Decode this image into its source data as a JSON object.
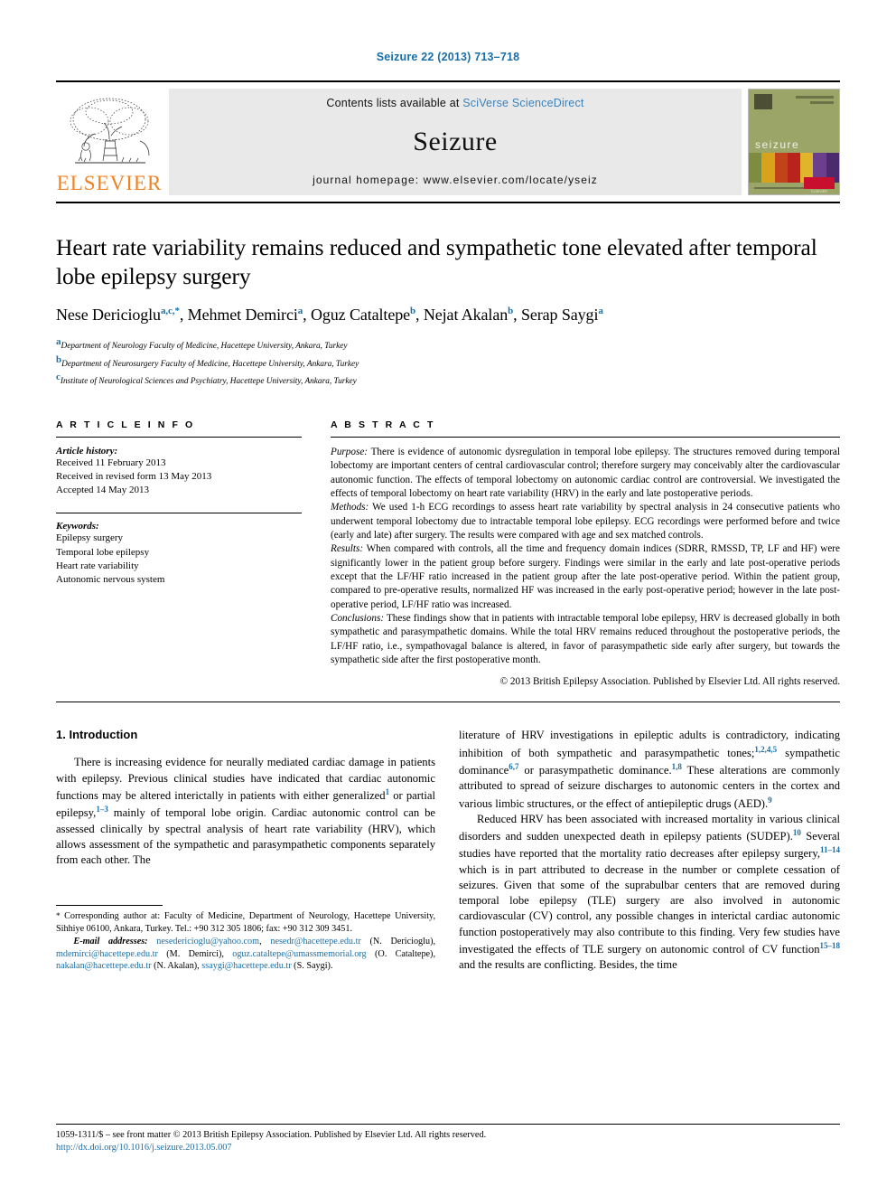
{
  "running_head": "Seizure 22 (2013) 713–718",
  "masthead": {
    "publisher_name": "ELSEVIER",
    "contents_prefix": "Contents lists available at ",
    "contents_link": "SciVerse ScienceDirect",
    "journal_name": "Seizure",
    "homepage": "journal homepage: www.elsevier.com/locate/yseiz",
    "cover": {
      "title": "seizure",
      "subtitle": "European Journal of Epilepsy",
      "publisher_badge": "ELSEVIER"
    }
  },
  "article": {
    "title": "Heart rate variability remains reduced and sympathetic tone elevated after temporal lobe epilepsy surgery",
    "authors": [
      {
        "name": "Nese Dericioglu",
        "sup": "a,c,*"
      },
      {
        "name": "Mehmet Demirci",
        "sup": "a"
      },
      {
        "name": "Oguz Cataltepe",
        "sup": "b"
      },
      {
        "name": "Nejat Akalan",
        "sup": "b"
      },
      {
        "name": "Serap Saygi",
        "sup": "a"
      }
    ],
    "affiliations": [
      {
        "mark": "a",
        "text": "Department of Neurology Faculty of Medicine, Hacettepe University, Ankara, Turkey"
      },
      {
        "mark": "b",
        "text": "Department of Neurosurgery Faculty of Medicine, Hacettepe University, Ankara, Turkey"
      },
      {
        "mark": "c",
        "text": "Institute of Neurological Sciences and Psychiatry, Hacettepe University, Ankara, Turkey"
      }
    ]
  },
  "article_info": {
    "heading": "A R T I C L E  I N F O",
    "history_label": "Article history:",
    "history": [
      "Received 11 February 2013",
      "Received in revised form 13 May 2013",
      "Accepted 14 May 2013"
    ],
    "keywords_label": "Keywords:",
    "keywords": [
      "Epilepsy surgery",
      "Temporal lobe epilepsy",
      "Heart rate variability",
      "Autonomic nervous system"
    ]
  },
  "abstract": {
    "heading": "A B S T R A C T",
    "purpose_label": "Purpose:",
    "purpose": " There is evidence of autonomic dysregulation in temporal lobe epilepsy. The structures removed during temporal lobectomy are important centers of central cardiovascular control; therefore surgery may conceivably alter the cardiovascular autonomic function. The effects of temporal lobectomy on autonomic cardiac control are controversial. We investigated the effects of temporal lobectomy on heart rate variability (HRV) in the early and late postoperative periods.",
    "methods_label": "Methods:",
    "methods": " We used 1-h ECG recordings to assess heart rate variability by spectral analysis in 24 consecutive patients who underwent temporal lobectomy due to intractable temporal lobe epilepsy. ECG recordings were performed before and twice (early and late) after surgery. The results were compared with age and sex matched controls.",
    "results_label": "Results:",
    "results": "  When compared with controls, all the time and frequency domain indices (SDRR, RMSSD, TP, LF and HF) were significantly lower in the patient group before surgery. Findings were similar in the early and late post-operative periods except that the LF/HF ratio increased in the patient group after the late post-operative period. Within the patient group, compared to pre-operative results, normalized HF was increased in the early post-operative period; however in the late post-operative period, LF/HF ratio was increased.",
    "conclusions_label": "Conclusions:",
    "conclusions": " These findings show that in patients with intractable temporal lobe epilepsy, HRV is decreased globally in both sympathetic and parasympathetic domains. While the total HRV remains reduced throughout the postoperative periods, the LF/HF ratio, i.e., sympathovagal balance is altered, in favor of parasympathetic side early after surgery, but towards the sympathetic side after the first postoperative month.",
    "copyright": "© 2013 British Epilepsy Association. Published by Elsevier Ltd. All rights reserved."
  },
  "introduction": {
    "heading": "1. Introduction",
    "left_p1_a": "There is increasing evidence for neurally mediated cardiac damage in patients with epilepsy. Previous clinical studies have indicated that cardiac autonomic functions may be altered interictally in patients with either generalized",
    "left_ref1": "1",
    "left_p1_b": " or partial epilepsy,",
    "left_ref2": "1–3",
    "left_p1_c": " mainly of temporal lobe origin. Cardiac autonomic control can be assessed clinically by spectral analysis of heart rate variability (HRV), which allows assessment of the sympathetic and parasympathetic components separately from each other. The",
    "right_p1_a": "literature of HRV investigations in epileptic adults is contradictory, indicating inhibition of both sympathetic and parasympathetic tones;",
    "right_ref1": "1,2,4,5",
    "right_p1_b": " sympathetic dominance",
    "right_ref2": "6,7",
    "right_p1_c": " or parasympathetic dominance.",
    "right_ref3": "1,8",
    "right_p1_d": " These alterations are commonly attributed to spread of seizure discharges to autonomic centers in the cortex and various limbic structures, or the effect of antiepileptic drugs (AED).",
    "right_ref4": "9",
    "right_p2_a": "Reduced HRV has been associated with increased mortality in various clinical disorders and sudden unexpected death in epilepsy patients (SUDEP).",
    "right_ref5": "10",
    "right_p2_b": " Several studies have reported that the mortality ratio decreases after epilepsy surgery,",
    "right_ref6": "11–14",
    "right_p2_c": " which is in part attributed to decrease in the number or complete cessation of seizures. Given that some of the suprabulbar centers that are removed during temporal lobe epilepsy (TLE) surgery are also involved in autonomic cardiovascular (CV) control, any possible changes in interictal cardiac autonomic function postoperatively may also contribute to this finding. Very few studies have investigated the effects of TLE surgery on autonomic control of CV function",
    "right_ref7": "15–18",
    "right_p2_d": " and the results are conflicting. Besides, the time"
  },
  "footnote": {
    "corresponding": "Corresponding author at: Faculty of Medicine, Department of Neurology, Hacettepe University, Sihhiye 06100, Ankara, Turkey. Tel.: +90 312 305 1806; fax: +90 312 309 3451.",
    "email_label": "E-mail addresses:",
    "emails": [
      {
        "addr": "nesedericioglu@yahoo.com",
        "sep": ", "
      },
      {
        "addr": "nesedr@hacettepe.edu.tr",
        "sep": " "
      }
    ],
    "email_line": " (N. Dericioglu), ",
    "email2": "mdemirci@hacettepe.edu.tr",
    "email2_owner": " (M. Demirci), ",
    "email3": "oguz.cataltepe@umassmemorial.org",
    "email3_owner": " (O. Cataltepe), ",
    "email4": "nakalan@hacettepe.edu.tr",
    "email4_owner": " (N. Akalan), ",
    "email5": "ssaygi@hacettepe.edu.tr",
    "email5_owner": " (S. Saygi)."
  },
  "page_footer": {
    "front_matter": "1059-1311/$ – see front matter © 2013 British Epilepsy Association. Published by Elsevier Ltd. All rights reserved.",
    "doi": "http://dx.doi.org/10.1016/j.seizure.2013.05.007"
  },
  "colors": {
    "link_blue": "#1a6ea8",
    "sciverse_blue": "#3b82bd",
    "elsevier_orange": "#F08122",
    "masthead_gray": "#e9e9e9",
    "cover_green": "#9aa567"
  }
}
